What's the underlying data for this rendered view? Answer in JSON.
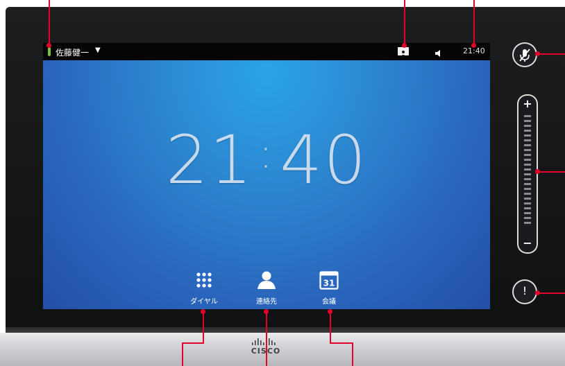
{
  "status_bar": {
    "user_name": "佐藤健一",
    "user_menu_caret": "▼",
    "contact_icon": "contact-card-icon",
    "speaker_icon": "speaker-icon",
    "time": "21:40"
  },
  "home": {
    "clock_hours": "21",
    "clock_separator": ":",
    "clock_minutes": "40",
    "launchers": [
      {
        "icon": "dialpad-icon",
        "label": "ダイヤル"
      },
      {
        "icon": "contacts-person-icon",
        "label": "連絡先"
      },
      {
        "icon": "calendar-icon",
        "label": "会議",
        "calendar_day": "31"
      }
    ]
  },
  "side_controls": {
    "mute_icon": "microphone-muted-icon",
    "volume_plus": "+",
    "volume_minus": "−",
    "alert_symbol": "!"
  },
  "brand": {
    "logo_word": "CISCO"
  },
  "colors": {
    "callout": "#e4002b",
    "presence": "#7cc23a",
    "wallpaper_top": "#2aa4e6",
    "wallpaper_bottom": "#2450a8"
  }
}
